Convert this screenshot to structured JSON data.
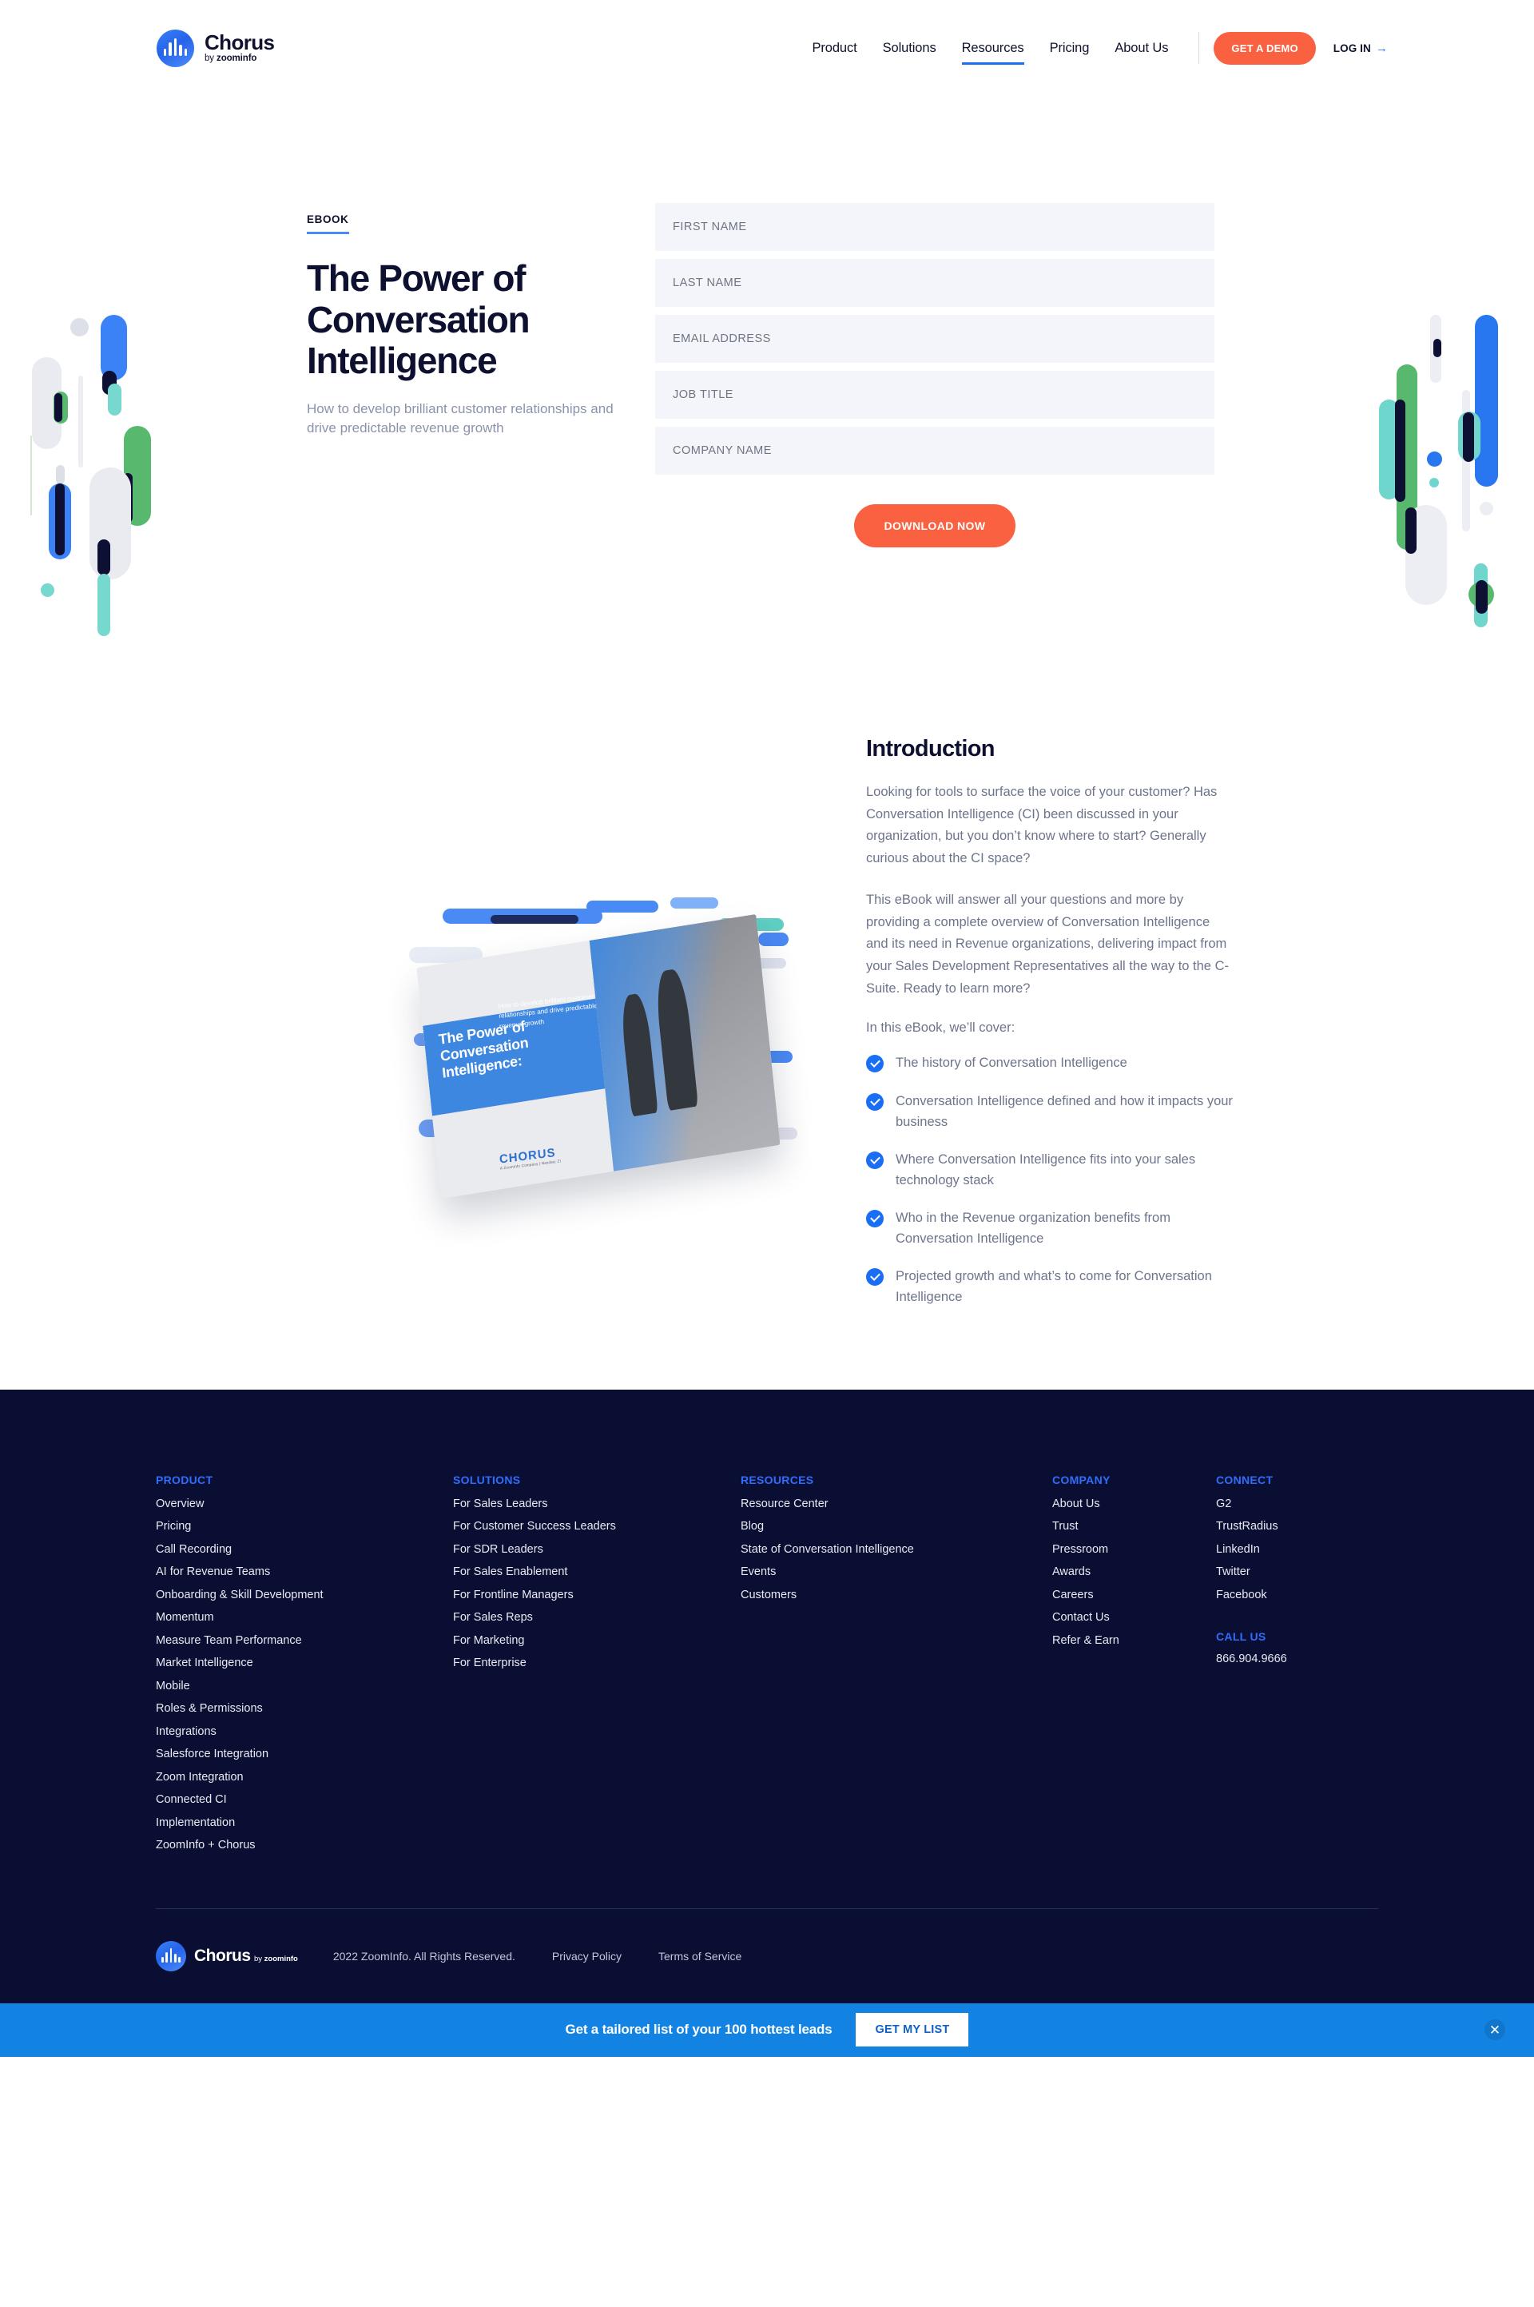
{
  "header": {
    "brand": {
      "name": "Chorus",
      "by": "by ",
      "sub": "zoominfo"
    },
    "nav": [
      {
        "label": "Product",
        "active": false
      },
      {
        "label": "Solutions",
        "active": false
      },
      {
        "label": "Resources",
        "active": true
      },
      {
        "label": "Pricing",
        "active": false
      },
      {
        "label": "About Us",
        "active": false
      }
    ],
    "demo_button": "GET A DEMO",
    "login": "LOG IN",
    "login_arrow": "→"
  },
  "hero": {
    "eyebrow": "EBOOK",
    "title": "The Power of Conversation Intelligence",
    "subtitle": "How to develop brilliant customer relationships and drive predictable revenue growth"
  },
  "form": {
    "fields": [
      {
        "name": "first-name",
        "placeholder": "FIRST NAME",
        "value": ""
      },
      {
        "name": "last-name",
        "placeholder": "LAST NAME",
        "value": ""
      },
      {
        "name": "email-address",
        "placeholder": "EMAIL ADDRESS",
        "value": ""
      },
      {
        "name": "job-title",
        "placeholder": "JOB TITLE",
        "value": ""
      },
      {
        "name": "company-name",
        "placeholder": "COMPANY NAME",
        "value": ""
      }
    ],
    "submit_label": "DOWNLOAD NOW"
  },
  "book_cover": {
    "title": "The Power of Conversation Intelligence:",
    "subtitle": "How to develop brilliant customer relationships and drive predictable revenue growth",
    "logo": "CHORUS",
    "logo_sub": "A ZoomInfo Company | Nasdaq: ZI"
  },
  "intro": {
    "heading": "Introduction",
    "paragraph1": "Looking for tools to surface the voice of your customer? Has Conversation Intelligence (CI) been discussed in your organization, but you don’t know where to start? Generally curious about the CI space?",
    "paragraph2": "This eBook will answer all your questions and more by providing a complete overview of Conversation Intelligence and its need in Revenue organizations, delivering impact from your Sales Development Representatives all the way to the C-Suite. Ready to learn more?",
    "lead_in": "In this eBook, we’ll cover:",
    "bullets": [
      "The history of Conversation Intelligence",
      "Conversation Intelligence defined and how it impacts your business",
      "Where Conversation Intelligence fits into your sales technology stack",
      "Who in the Revenue organization benefits from Conversation Intelligence",
      "Projected growth and what’s to come for Conversation Intelligence"
    ]
  },
  "footer": {
    "columns": [
      {
        "heading": "PRODUCT",
        "key": "product",
        "links": [
          "Overview",
          "Pricing",
          "Call Recording",
          "AI for Revenue Teams",
          "Onboarding & Skill Development",
          "Momentum",
          "Measure Team Performance",
          "Market Intelligence",
          "Mobile",
          "Roles & Permissions",
          "Integrations",
          "Salesforce Integration",
          "Zoom Integration",
          "Connected CI",
          "Implementation",
          "ZoomInfo + Chorus"
        ]
      },
      {
        "heading": "SOLUTIONS",
        "key": "solutions",
        "links": [
          "For Sales Leaders",
          "For Customer Success Leaders",
          "For SDR Leaders",
          "For Sales Enablement",
          "For Frontline Managers",
          "For Sales Reps",
          "For Marketing",
          "For Enterprise"
        ]
      },
      {
        "heading": "RESOURCES",
        "key": "resources",
        "links": [
          "Resource Center",
          "Blog",
          "State of Conversation Intelligence",
          "Events",
          "Customers"
        ]
      },
      {
        "heading": "COMPANY",
        "key": "company",
        "links": [
          "About Us",
          "Trust",
          "Pressroom",
          "Awards",
          "Careers",
          "Contact Us",
          "Refer & Earn"
        ]
      },
      {
        "heading": "CONNECT",
        "key": "connect",
        "links": [
          "G2",
          "TrustRadius",
          "LinkedIn",
          "Twitter",
          "Facebook"
        ],
        "call_us_heading": "CALL US",
        "phone": "866.904.9666"
      }
    ],
    "bottom": {
      "brand_name": "Chorus",
      "brand_by": "by ",
      "brand_sub": "zoominfo",
      "copyright": "2022 ZoomInfo. All Rights Reserved.",
      "links": [
        "Privacy Policy",
        "Terms of Service"
      ]
    }
  },
  "cta_banner": {
    "text": "Get a tailored list of your 100 hottest leads",
    "button": "GET MY LIST",
    "close_icon": "✕"
  },
  "colors": {
    "accent_orange": "#fa6141",
    "accent_blue": "#1d6ef3",
    "footer_bg": "#0b0e33",
    "cta_bg": "#1283e2",
    "ink": "#0e1030",
    "muted": "#6d748c"
  }
}
